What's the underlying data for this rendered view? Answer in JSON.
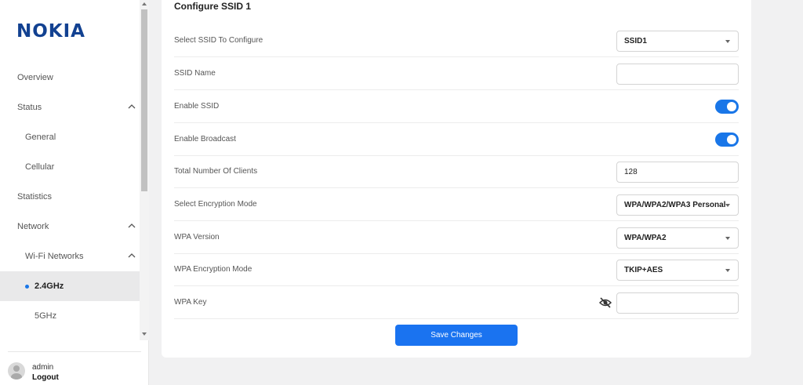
{
  "brand": {
    "logo_text": "NOKIA",
    "color": "#124191"
  },
  "sidebar": {
    "items": [
      {
        "label": "Overview",
        "level": 1
      },
      {
        "label": "Status",
        "level": 1,
        "expanded": true
      },
      {
        "label": "General",
        "level": 2
      },
      {
        "label": "Cellular",
        "level": 2
      },
      {
        "label": "Statistics",
        "level": 1
      },
      {
        "label": "Network",
        "level": 1,
        "expanded": true
      },
      {
        "label": "Wi-Fi Networks",
        "level": 2,
        "expanded": true
      },
      {
        "label": "2.4GHz",
        "level": 3,
        "active": true
      },
      {
        "label": "5GHz",
        "level": 3
      }
    ],
    "user": {
      "name": "admin",
      "logout_label": "Logout"
    }
  },
  "form": {
    "title": "Configure SSID 1",
    "rows": [
      {
        "label": "Select SSID To Configure",
        "type": "select",
        "value": "SSID1"
      },
      {
        "label": "SSID Name",
        "type": "input",
        "value": ""
      },
      {
        "label": "Enable SSID",
        "type": "toggle",
        "value": "on"
      },
      {
        "label": "Enable Broadcast",
        "type": "toggle",
        "value": "on"
      },
      {
        "label": "Total Number Of Clients",
        "type": "input",
        "value": "128"
      },
      {
        "label": "Select Encryption Mode",
        "type": "select",
        "value": "WPA/WPA2/WPA3 Personal"
      },
      {
        "label": "WPA Version",
        "type": "select",
        "value": "WPA/WPA2"
      },
      {
        "label": "WPA Encryption Mode",
        "type": "select",
        "value": "TKIP+AES"
      },
      {
        "label": "WPA Key",
        "type": "password",
        "value": ""
      }
    ],
    "save_label": "Save Changes"
  },
  "colors": {
    "accent": "#1976e8",
    "active_bg": "#e9e9ea"
  },
  "icons": {
    "password_toggle": "eye-off-icon",
    "expand": "chevron-up-icon",
    "user": "user-avatar-icon"
  }
}
